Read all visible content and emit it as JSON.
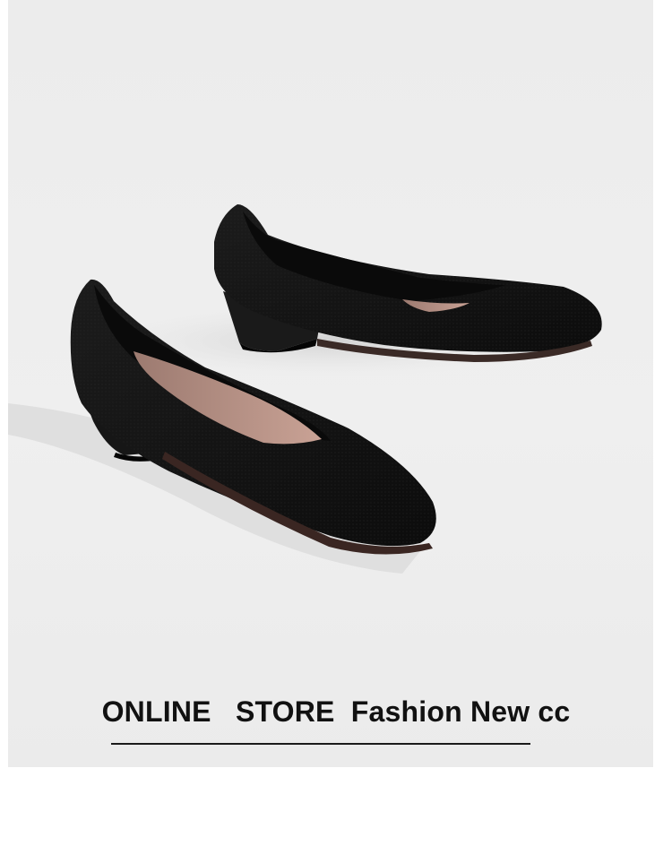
{
  "caption": {
    "text": "ONLINE   STORE  Fashion New cc"
  },
  "colors": {
    "background": "#ececec",
    "shoe": "#141414",
    "insole": "#b28c80",
    "caption_text": "#111111"
  },
  "photo": {
    "subject": "black knit pointed-toe wedge pumps"
  }
}
